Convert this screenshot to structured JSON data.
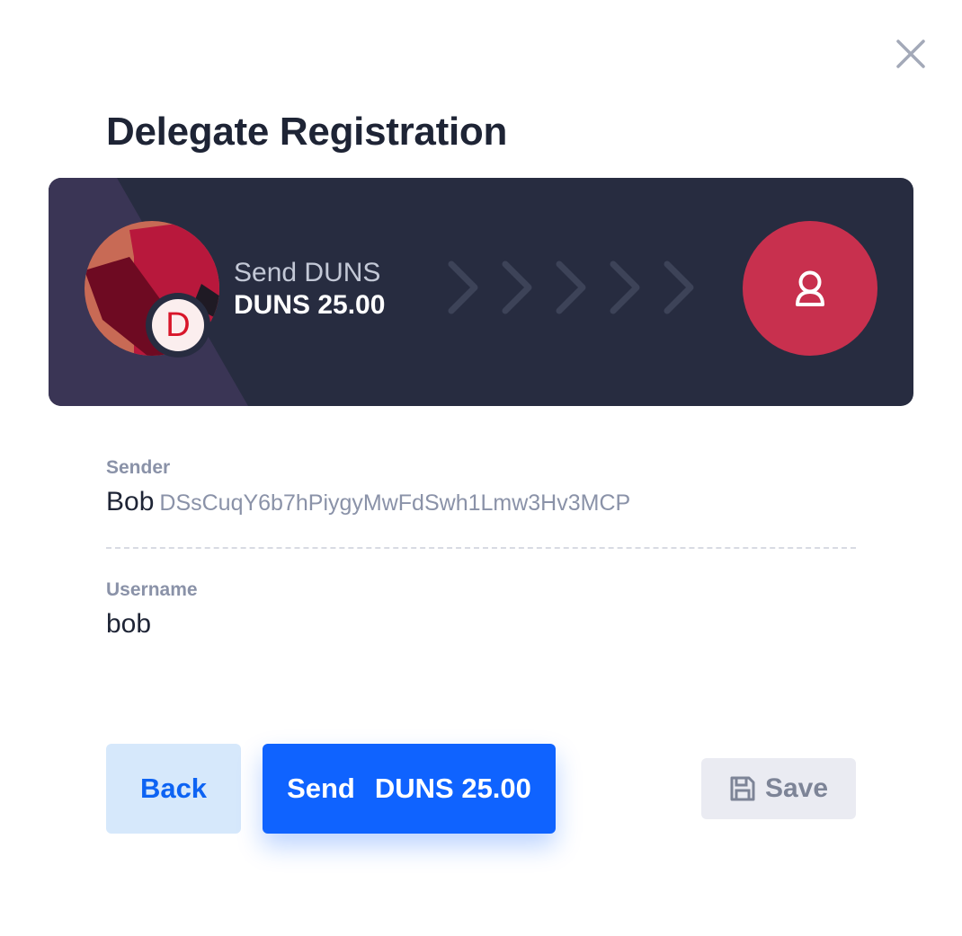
{
  "dialog": {
    "title": "Delegate Registration",
    "close_icon": "close-icon"
  },
  "banner": {
    "send_label": "Send DUNS",
    "amount": "DUNS 25.00",
    "token_letter": "D",
    "sender_avatar_icon": "abstract-avatar-icon",
    "arrows_icon": "chevron-right-icon",
    "recipient_icon": "user-icon",
    "colors": {
      "background": "#272c40",
      "stripe": "#3a3555",
      "recipient": "#c8304e",
      "token_letter": "#d8162a"
    }
  },
  "sender": {
    "label": "Sender",
    "name": "Bob",
    "address": "DSsCuqY6b7hPiygyMwFdSwh1Lmw3Hv3MCP"
  },
  "username": {
    "label": "Username",
    "value": "bob"
  },
  "actions": {
    "back_label": "Back",
    "send_label": "Send",
    "send_amount": "DUNS 25.00",
    "save_label": "Save",
    "save_icon": "floppy-disk-icon",
    "primary_color": "#0f63ff"
  }
}
